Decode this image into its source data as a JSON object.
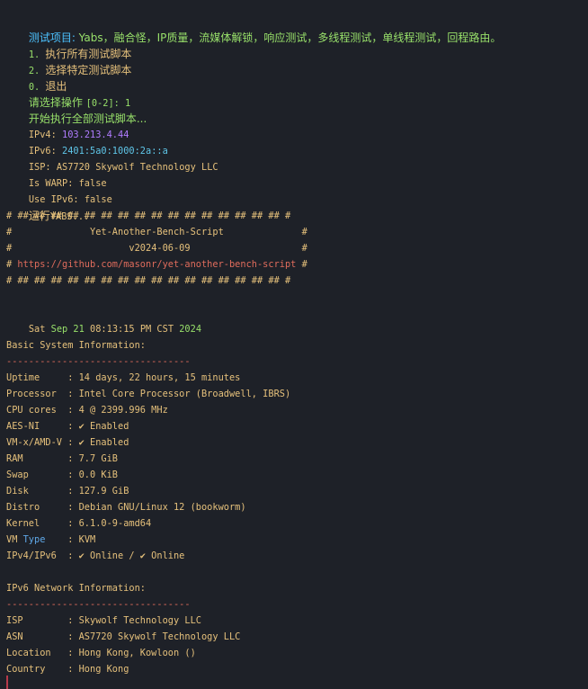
{
  "header": {
    "prefix": "测试项目: ",
    "items": "Yabs，融合怪，IP质量，流媒体解锁，响应测试，多线程测试，单线程测试，回程路由。"
  },
  "menu": [
    {
      "num": "1.",
      "label": "执行所有测试脚本"
    },
    {
      "num": "2.",
      "label": "选择特定测试脚本"
    },
    {
      "num": "0.",
      "label": "退出"
    }
  ],
  "prompt": {
    "label": "请选择操作 ",
    "range": "[0-2]:",
    "answer": " 1"
  },
  "start_msg": "开始执行全部测试脚本...",
  "net": {
    "ipv4_label": "IPv4: ",
    "ipv4": "103.213.4.44",
    "ipv6_label": "IPv6: ",
    "ipv6": "2401:5a0:1000:2a::a",
    "isp_label": "ISP: ",
    "isp": "AS7720 Skywolf Technology LLC",
    "warp_label": "Is WARP: ",
    "warp": "false",
    "useipv6_label": "Use IPv6: ",
    "useipv6": "false"
  },
  "run": {
    "prefix": "运行",
    "name": "YABS..."
  },
  "banner": {
    "border": "# ## ## ## ## ## ## ## ## ## ## ## ## ## ## ## ## #",
    "title_pre": "#              ",
    "title": "Yet-Another-Bench-Script",
    "title_post": "              #",
    "ver_pre": "#                     ",
    "version": "v2024-06-09",
    "ver_post": "                    #",
    "url_pre": "# ",
    "url": "https://github.com/masonr/yet-another-bench-script",
    "url_post": " #"
  },
  "date": {
    "dow": "Sat ",
    "month_day": "Sep 21 ",
    "time": "08:13:15 PM CST ",
    "year": "2024"
  },
  "sys": {
    "title": "Basic System Information:",
    "divider": "---------------------------------",
    "rows": [
      {
        "key": "Uptime     : ",
        "value": "14 days, 22 hours, 15 minutes"
      },
      {
        "key": "Processor  : ",
        "value": "Intel Core Processor (Broadwell, IBRS)"
      },
      {
        "key": "CPU cores  : ",
        "value": "4 @ 2399.996 MHz"
      },
      {
        "key": "AES-NI     : ",
        "value": "✔ Enabled"
      },
      {
        "key": "VM-x/AMD-V : ",
        "value": "✔ Enabled"
      },
      {
        "key": "RAM        : ",
        "value": "7.7 GiB"
      },
      {
        "key": "Swap       : ",
        "value": "0.0 KiB"
      },
      {
        "key": "Disk       : ",
        "value": "127.9 GiB"
      },
      {
        "key": "Distro     : ",
        "value": "Debian GNU/Linux 12 (bookworm)"
      },
      {
        "key": "Kernel     : ",
        "value": "6.1.0-9-amd64"
      },
      {
        "key_a": "VM ",
        "key_b": "Type",
        "key_c": "    : ",
        "value": "KVM"
      },
      {
        "key": "IPv4/IPv6  : ",
        "value": "✔ Online / ✔ Online"
      }
    ]
  },
  "ipv6net": {
    "title": "IPv6 Network Information:",
    "divider": "---------------------------------",
    "rows": [
      {
        "key": "ISP        : ",
        "value": "Skywolf Technology LLC"
      },
      {
        "key": "ASN        : ",
        "value": "AS7720 Skywolf Technology LLC"
      },
      {
        "key": "Location   : ",
        "value": "Hong Kong, Kowloon ()"
      },
      {
        "key": "Country    : ",
        "value": "Hong Kong"
      }
    ]
  },
  "colors": {
    "background": "#1e2128",
    "cyan": "#4cc2ff",
    "green": "#98e06a",
    "yellow": "#e5c07b",
    "purple": "#b07cff",
    "red": "#e06c5c"
  }
}
